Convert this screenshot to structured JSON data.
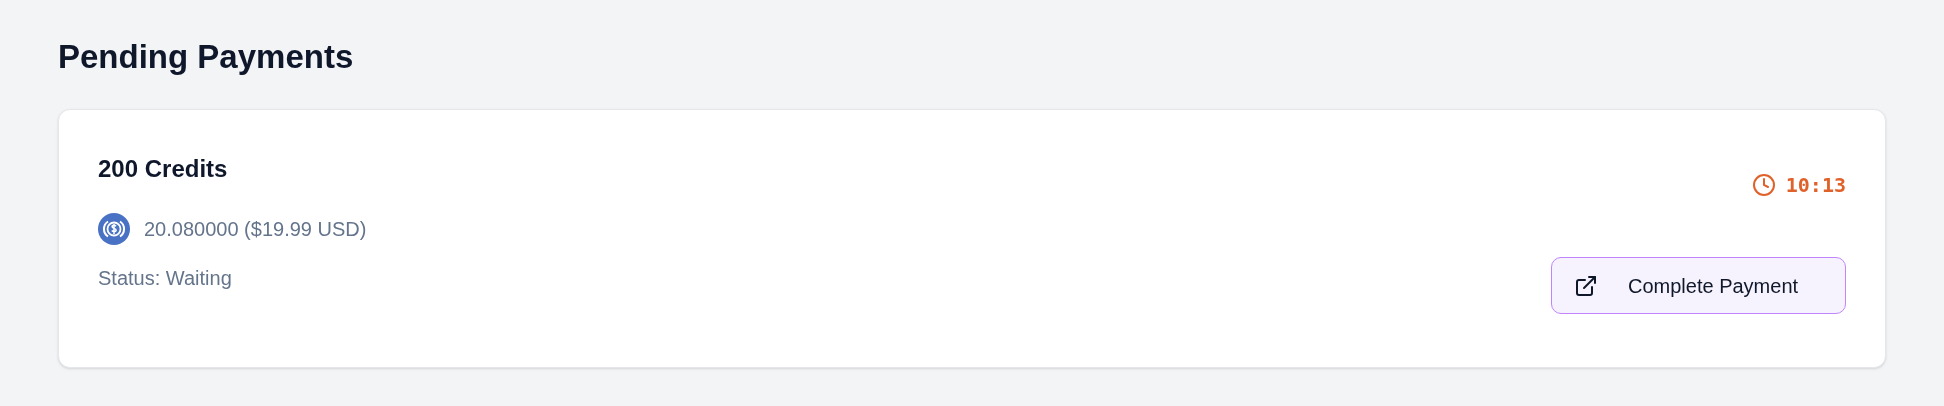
{
  "page_title": "Pending Payments",
  "payments": [
    {
      "title": "200 Credits",
      "amount": "20.080000 ($19.99 USD)",
      "status": "Status: Waiting",
      "timer": "10:13",
      "button": "Complete Payment"
    }
  ]
}
